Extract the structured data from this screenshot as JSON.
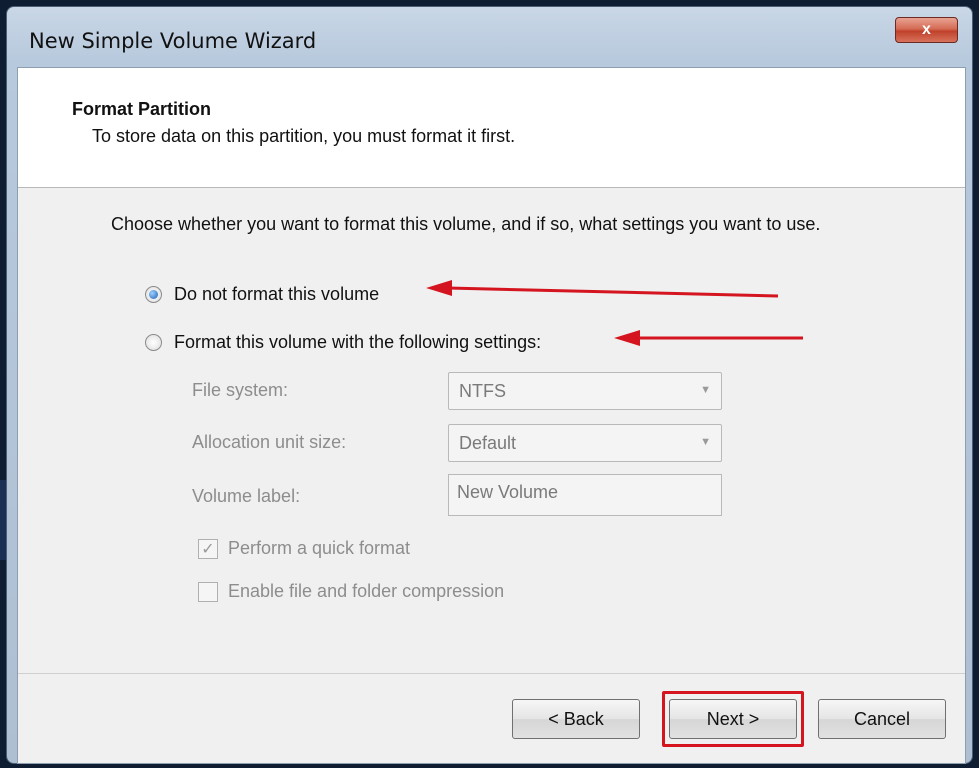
{
  "window": {
    "title": "New Simple Volume Wizard",
    "close_label": "x"
  },
  "header": {
    "title": "Format Partition",
    "subtitle": "To store data on this partition, you must format it first."
  },
  "main": {
    "intro": "Choose whether you want to format this volume, and if so, what settings you want to use.",
    "option_no_format": {
      "label": "Do not format this volume",
      "selected": true
    },
    "option_format": {
      "label": "Format this volume with the following settings:",
      "selected": false
    },
    "file_system": {
      "label": "File system:",
      "value": "NTFS"
    },
    "allocation": {
      "label": "Allocation unit size:",
      "value": "Default"
    },
    "volume_label": {
      "label": "Volume label:",
      "value": "New Volume"
    },
    "quick_format": {
      "label": "Perform a quick format",
      "checked": true
    },
    "compression": {
      "label": "Enable file and folder compression",
      "checked": false
    }
  },
  "buttons": {
    "back": "< Back",
    "next": "Next >",
    "cancel": "Cancel"
  },
  "colors": {
    "annotation_red": "#d4151f",
    "accent_blue": "#1d5fb5"
  },
  "icons": {
    "close": "close-icon",
    "dropdown": "chevron-down-icon",
    "check": "checkmark-icon"
  }
}
